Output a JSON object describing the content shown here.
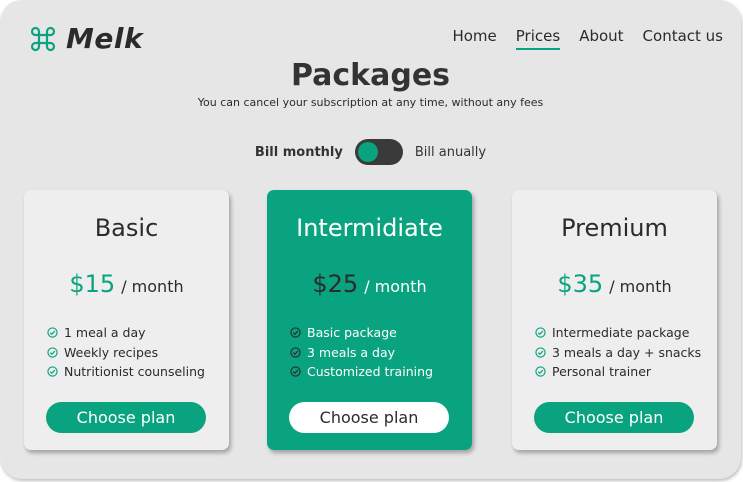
{
  "brand": {
    "name": "Melk",
    "icon": "command-key-icon",
    "accent_color": "#0aa37f"
  },
  "nav": {
    "items": [
      {
        "label": "Home",
        "active": false
      },
      {
        "label": "Prices",
        "active": true
      },
      {
        "label": "About",
        "active": false
      },
      {
        "label": "Contact us",
        "active": false
      }
    ]
  },
  "hero": {
    "title": "Packages",
    "subtitle": "You can cancel your subscription at any time, without any fees"
  },
  "billing": {
    "monthly_label": "Bill monthly",
    "annual_label": "Bill anually",
    "selected": "monthly"
  },
  "plans": [
    {
      "name": "Basic",
      "price": "$15",
      "period": "/ month",
      "features": [
        "1 meal a day",
        "Weekly recipes",
        "Nutritionist counseling"
      ],
      "button_label": "Choose plan"
    },
    {
      "name": "Intermidiate",
      "price": "$25",
      "period": "/ month",
      "features": [
        "Basic package",
        "3 meals a day",
        "Customized training"
      ],
      "button_label": "Choose plan",
      "highlighted": true
    },
    {
      "name": "Premium",
      "price": "$35",
      "period": "/ month",
      "features": [
        "Intermediate package",
        "3 meals a day + snacks",
        "Personal trainer"
      ],
      "button_label": "Choose plan"
    }
  ]
}
